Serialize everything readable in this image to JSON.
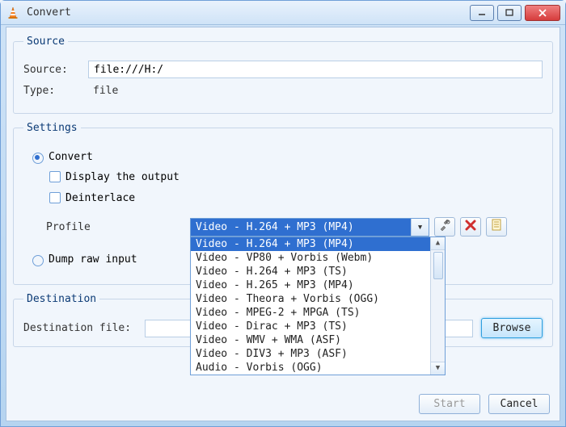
{
  "window": {
    "title": "Convert"
  },
  "source_group": {
    "legend": "Source",
    "source_label": "Source:",
    "source_value": "file:///H:/",
    "type_label": "Type:",
    "type_value": "file"
  },
  "settings_group": {
    "legend": "Settings",
    "convert_label": "Convert",
    "display_output_label": "Display the output",
    "deinterlace_label": "Deinterlace",
    "profile_label": "Profile",
    "profile_selected": "Video - H.264 + MP3 (MP4)",
    "profile_options": [
      "Video - H.264 + MP3 (MP4)",
      "Video - VP80 + Vorbis (Webm)",
      "Video - H.264 + MP3 (TS)",
      "Video - H.265 + MP3 (MP4)",
      "Video - Theora + Vorbis (OGG)",
      "Video - MPEG-2 + MPGA (TS)",
      "Video - Dirac + MP3 (TS)",
      "Video - WMV + WMA (ASF)",
      "Video - DIV3 + MP3 (ASF)",
      "Audio - Vorbis (OGG)"
    ],
    "dump_raw_label": "Dump raw input"
  },
  "destination_group": {
    "legend": "Destination",
    "dest_label": "Destination file:",
    "dest_value": "",
    "browse_label": "Browse"
  },
  "footer": {
    "start_label": "Start",
    "cancel_label": "Cancel"
  },
  "icons": {
    "edit": "tools",
    "delete": "x",
    "new": "doc"
  }
}
